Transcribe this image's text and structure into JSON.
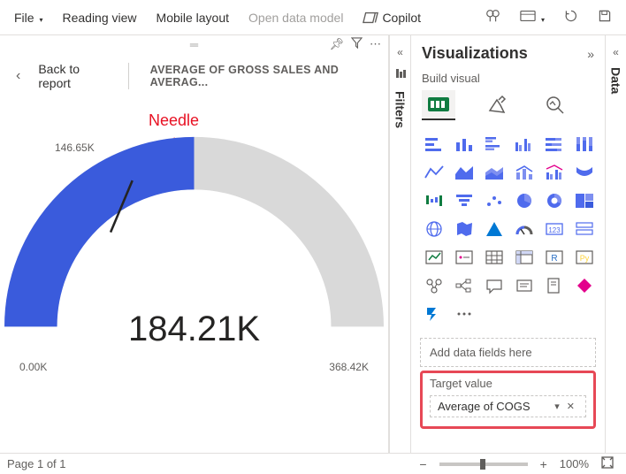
{
  "topbar": {
    "file": "File",
    "reading": "Reading view",
    "mobile": "Mobile layout",
    "datamodel": "Open data model",
    "copilot": "Copilot"
  },
  "canvas": {
    "back": "Back to report",
    "title": "AVERAGE OF GROSS SALES AND AVERAG...",
    "annotation": "Needle"
  },
  "chart_data": {
    "type": "gauge",
    "value": 184.21,
    "value_label": "184.21K",
    "min": 0,
    "min_label": "0.00K",
    "max": 368.42,
    "max_label": "368.42K",
    "target": 146.65,
    "target_label": "146.65K",
    "fill_color": "#3a5bdc",
    "track_color": "#d9d9d9"
  },
  "viz": {
    "title": "Visualizations",
    "build": "Build visual",
    "well_placeholder": "Add data fields here",
    "target_label": "Target value",
    "target_field": "Average of COGS"
  },
  "rightpanes": {
    "filters": "Filters",
    "data": "Data"
  },
  "footer": {
    "page": "Page 1 of 1",
    "zoom": "100%"
  }
}
